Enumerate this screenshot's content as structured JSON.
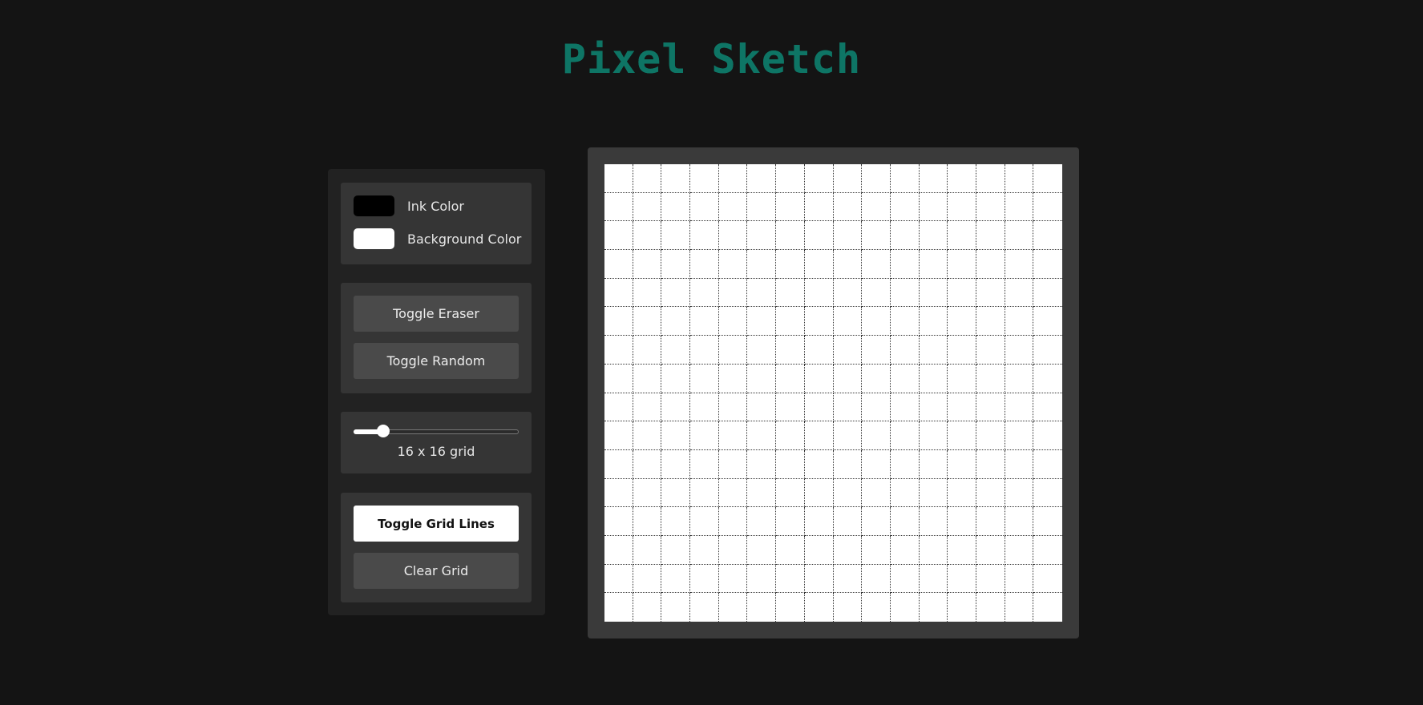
{
  "app": {
    "title": "Pixel Sketch",
    "title_color": "#0e7565"
  },
  "colors": {
    "ink_label": "Ink Color",
    "ink_value": "#000000",
    "background_label": "Background Color",
    "background_value": "#ffffff"
  },
  "tools": {
    "eraser_label": "Toggle Eraser",
    "random_label": "Toggle Random"
  },
  "size": {
    "grid_size": 16,
    "min": 1,
    "max": 100,
    "label": "16 x 16 grid"
  },
  "actions": {
    "grid_lines_label": "Toggle Grid Lines",
    "grid_lines_active": true,
    "clear_label": "Clear Grid"
  }
}
